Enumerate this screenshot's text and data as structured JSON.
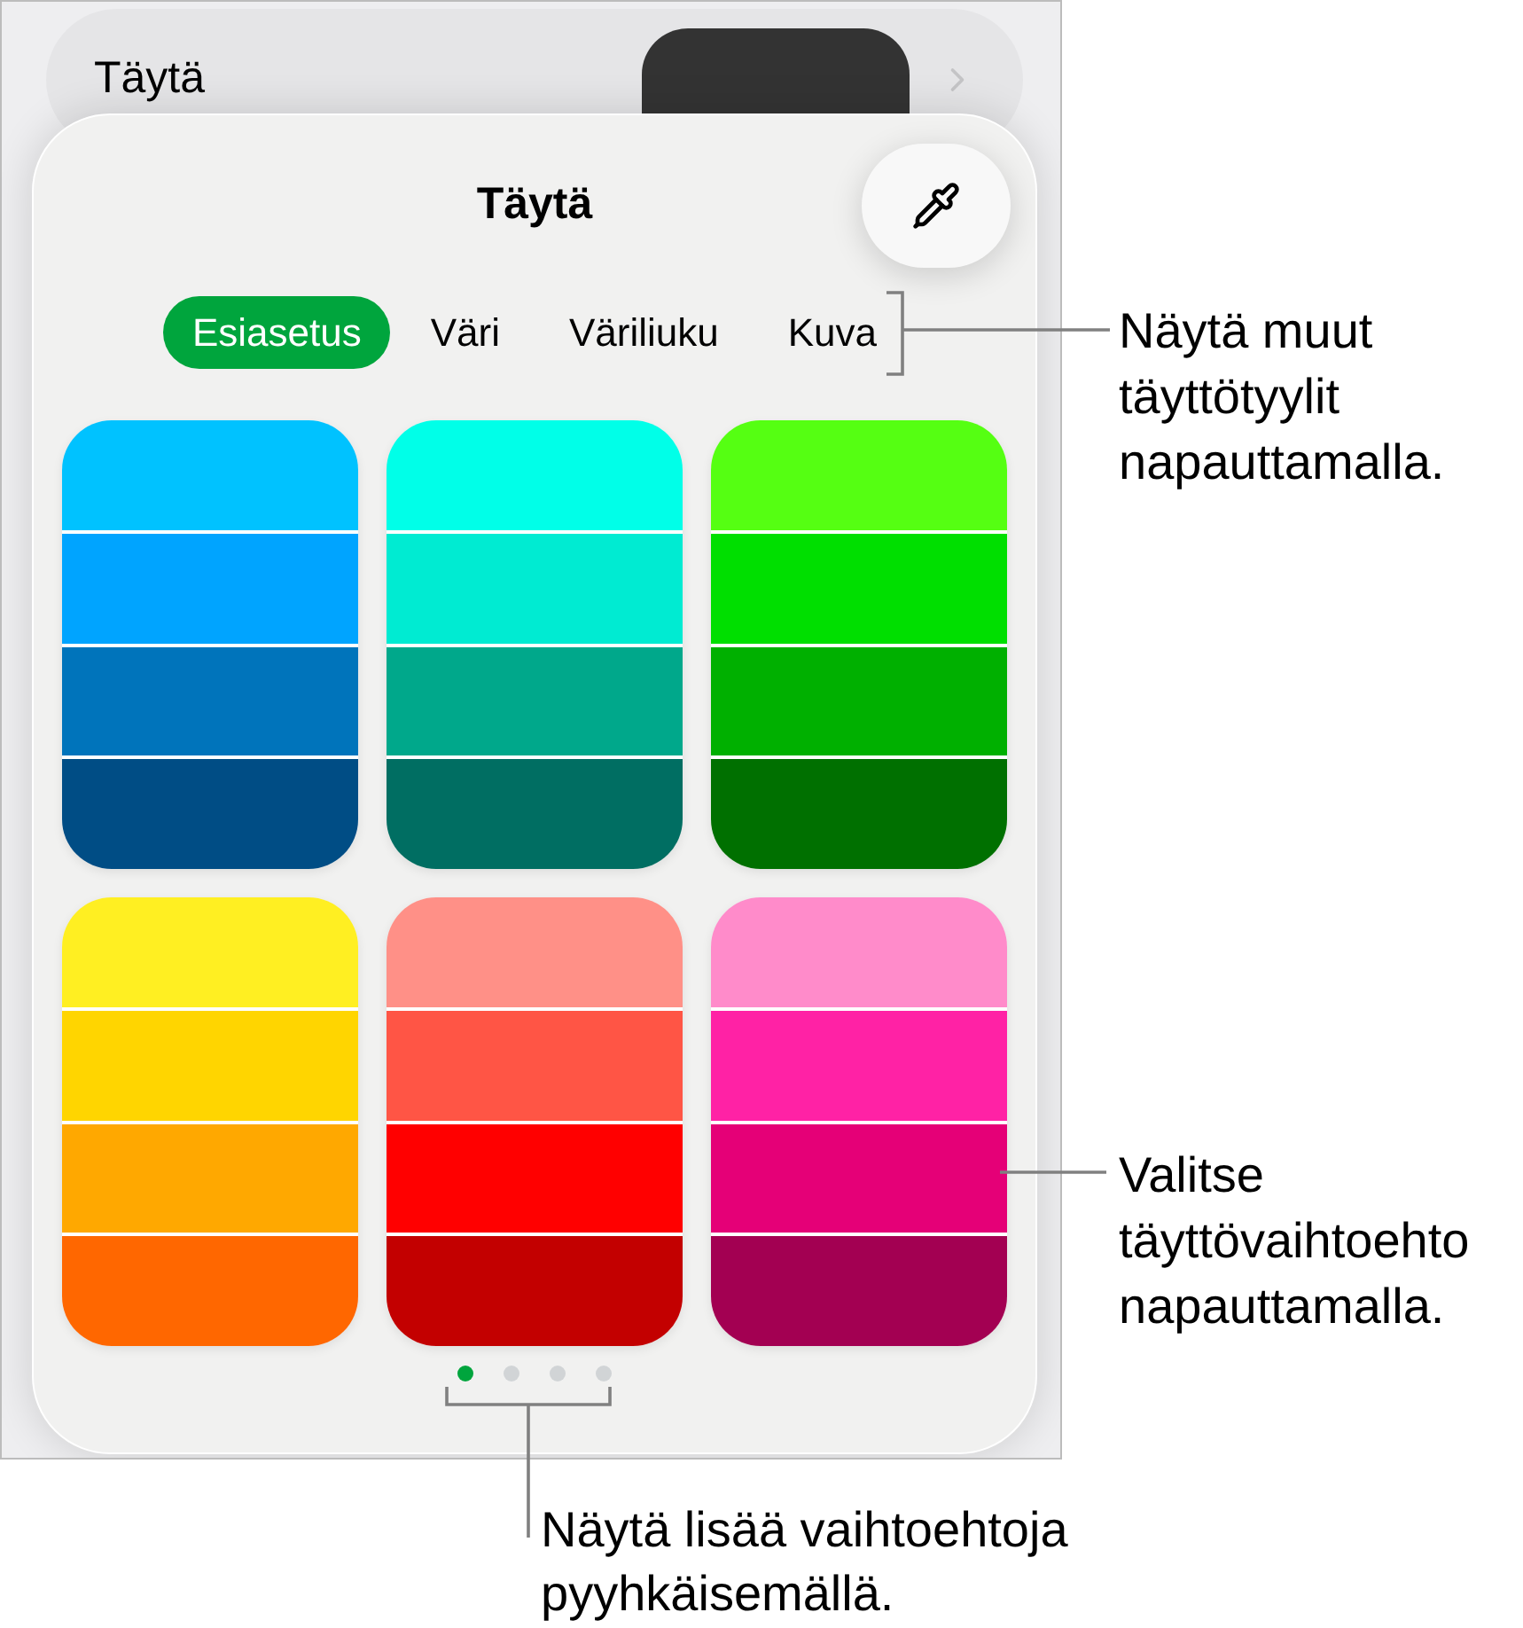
{
  "fill_row": {
    "label": "Täytä"
  },
  "panel": {
    "title": "Täytä"
  },
  "tabs": [
    {
      "label": "Esiasetus",
      "selected": true
    },
    {
      "label": "Väri",
      "selected": false
    },
    {
      "label": "Väriliuku",
      "selected": false
    },
    {
      "label": "Kuva",
      "selected": false
    }
  ],
  "presets": [
    {
      "stripes": [
        {
          "color": "#00c2ff"
        },
        {
          "color": "#00a4ff"
        },
        {
          "color": "#0074bb"
        },
        {
          "color": "#004d85"
        }
      ]
    },
    {
      "stripes": [
        {
          "color": "#00ffe8"
        },
        {
          "color": "#00ebd2"
        },
        {
          "color": "#00a88b"
        },
        {
          "color": "#006e62"
        }
      ]
    },
    {
      "stripes": [
        {
          "color": "#55ff12"
        },
        {
          "color": "#00df00"
        },
        {
          "color": "#00b000"
        },
        {
          "color": "#007000"
        }
      ]
    },
    {
      "stripes": [
        {
          "color": "#ffef22"
        },
        {
          "color": "#ffd500"
        },
        {
          "color": "#ffa800"
        },
        {
          "color": "#ff6700"
        }
      ]
    },
    {
      "stripes": [
        {
          "color": "#ff9087"
        },
        {
          "color": "#ff5545"
        },
        {
          "color": "#ff0000"
        },
        {
          "color": "#c30000"
        }
      ]
    },
    {
      "stripes": [
        {
          "color": "#ff8bca"
        },
        {
          "color": "#ff22a5"
        },
        {
          "color": "#e50077"
        },
        {
          "color": "#a30052"
        }
      ]
    }
  ],
  "page_dots": [
    {
      "selected": true
    },
    {
      "selected": false
    },
    {
      "selected": false
    },
    {
      "selected": false
    }
  ],
  "callouts": {
    "tabs": "Näytä muut täyttötyylit napauttamalla.",
    "presets": "Valitse täyttövaihtoehto napauttamalla.",
    "pages": "Näytä lisää vaihtoehtoja pyyhkäisemällä."
  }
}
